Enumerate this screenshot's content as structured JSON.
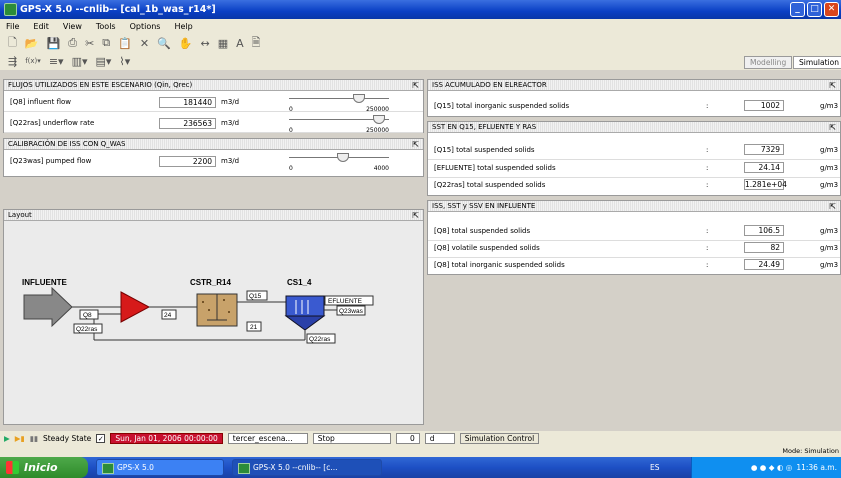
{
  "window": {
    "title": "GPS-X 5.0 --cnlib-- [cal_1b_was_r14*]"
  },
  "menu": {
    "items": [
      "File",
      "Edit",
      "View",
      "Tools",
      "Options",
      "Help"
    ]
  },
  "mode_tabs": {
    "modelling": "Modelling",
    "simulation": "Simulation"
  },
  "left": {
    "flujos": {
      "title": "FLUJOS UTILIZADOS EN ESTE ESCENARIO (Qin, Qrec)",
      "rows": [
        {
          "label": "[Q8] influent flow",
          "value": "181440",
          "unit": "m3/d",
          "min": "0",
          "max": "250000",
          "level": 0.73
        },
        {
          "label": "[Q22ras] underflow rate",
          "value": "236563",
          "unit": "m3/d",
          "min": "0",
          "max": "250000",
          "level": 0.95
        }
      ]
    },
    "calibracion": {
      "title": "CALIBRACIÓN DE ISS CON Q_WAS",
      "rows": [
        {
          "label": "[Q23was] pumped flow",
          "value": "2200",
          "unit": "m3/d",
          "min": "0",
          "max": "4000",
          "level": 0.55
        }
      ]
    },
    "layout": {
      "title": "Layout",
      "influente": "INFLUENTE",
      "cstr": "CSTR_R14",
      "cs": "CS1_4",
      "tags": {
        "q8": "Q8",
        "q22ras_a": "Q22ras",
        "n24": "24",
        "q15": "Q15",
        "n21": "21",
        "efluente": "EFLUENTE",
        "q23was": "Q23was",
        "q22ras_b": "Q22ras"
      }
    }
  },
  "right": {
    "iss": {
      "title": "ISS ACUMULADO EN ELREACTOR",
      "rows": [
        {
          "label": "[Q15] total inorganic suspended solids",
          "value": "1002",
          "unit": "g/m3"
        }
      ]
    },
    "sst": {
      "title": "SST EN Q15, EFLUENTE Y RAS",
      "rows": [
        {
          "label": "[Q15] total suspended solids",
          "value": "7329",
          "unit": "g/m3"
        },
        {
          "label": "[EFLUENTE] total suspended solids",
          "value": "24.14",
          "unit": "g/m3"
        },
        {
          "label": "[Q22ras] total suspended solids",
          "value": "1.281e+04",
          "unit": "g/m3"
        }
      ]
    },
    "influente": {
      "title": "ISS, SST y SSV EN INFLUENTE",
      "rows": [
        {
          "label": "[Q8] total suspended solids",
          "value": "106.5",
          "unit": "g/m3"
        },
        {
          "label": "[Q8] volatile suspended solids",
          "value": "82",
          "unit": "g/m3"
        },
        {
          "label": "[Q8] total inorganic suspended solids",
          "value": "24.49",
          "unit": "g/m3"
        }
      ]
    }
  },
  "status": {
    "steady_state": "Steady State",
    "date": "Sun, Jan 01, 2006  00:00:00",
    "scenario": "tercer_escena...",
    "stop": "Stop",
    "stop_value": "0",
    "stop_unit": "d",
    "sim_control": "Simulation Control",
    "mode": "Mode: Simulation"
  },
  "taskbar": {
    "start": "Inicio",
    "tasks": [
      "GPS-X 5.0",
      "GPS-X 5.0 --cnlib-- [c..."
    ],
    "lang": "ES",
    "time": "11:36 a.m."
  }
}
